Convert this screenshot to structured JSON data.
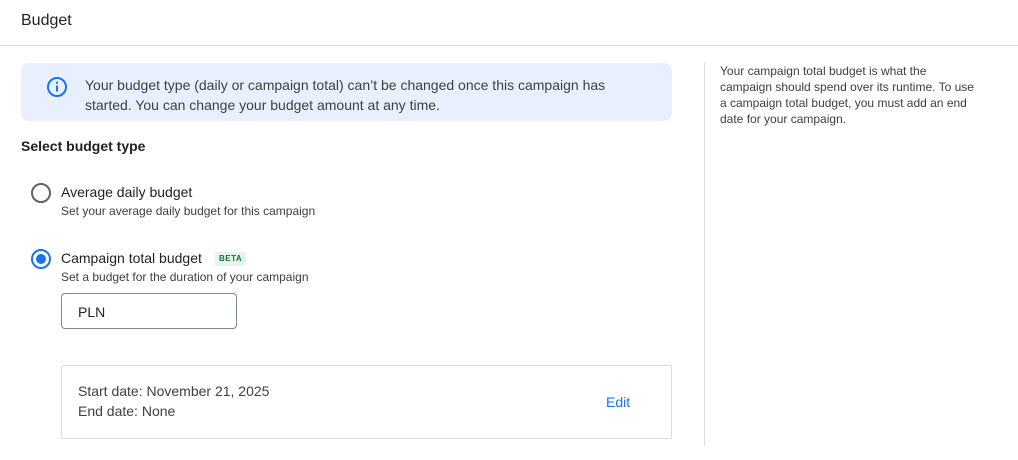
{
  "header": {
    "title": "Budget"
  },
  "banner": {
    "icon": "info-icon",
    "line1": "Your budget type (daily or campaign total) can’t be changed once this campaign has",
    "line2": "started. You can change your budget amount at any time."
  },
  "budget_type": {
    "section_title": "Select budget type",
    "options": [
      {
        "label": "Average daily budget",
        "description": "Set your average daily budget for this campaign",
        "selected": false
      },
      {
        "label": "Campaign total budget",
        "badge": "BETA",
        "description": "Set a budget for the duration of your campaign",
        "selected": true
      }
    ]
  },
  "amount_field": {
    "currency": "PLN",
    "value": ""
  },
  "dates": {
    "start": "Start date: November 21, 2025",
    "end": "End date: None",
    "edit_label": "Edit"
  },
  "help": {
    "line1": "Your campaign total budget is what the",
    "line2": "campaign should spend over its runtime. To use",
    "line3": "a campaign total budget, you must add an end",
    "line4": "date for your campaign."
  },
  "colors": {
    "accent": "#1a73e8",
    "banner_bg": "#e8f0fe",
    "beta_bg": "#e6f4ea",
    "beta_fg": "#137333"
  }
}
